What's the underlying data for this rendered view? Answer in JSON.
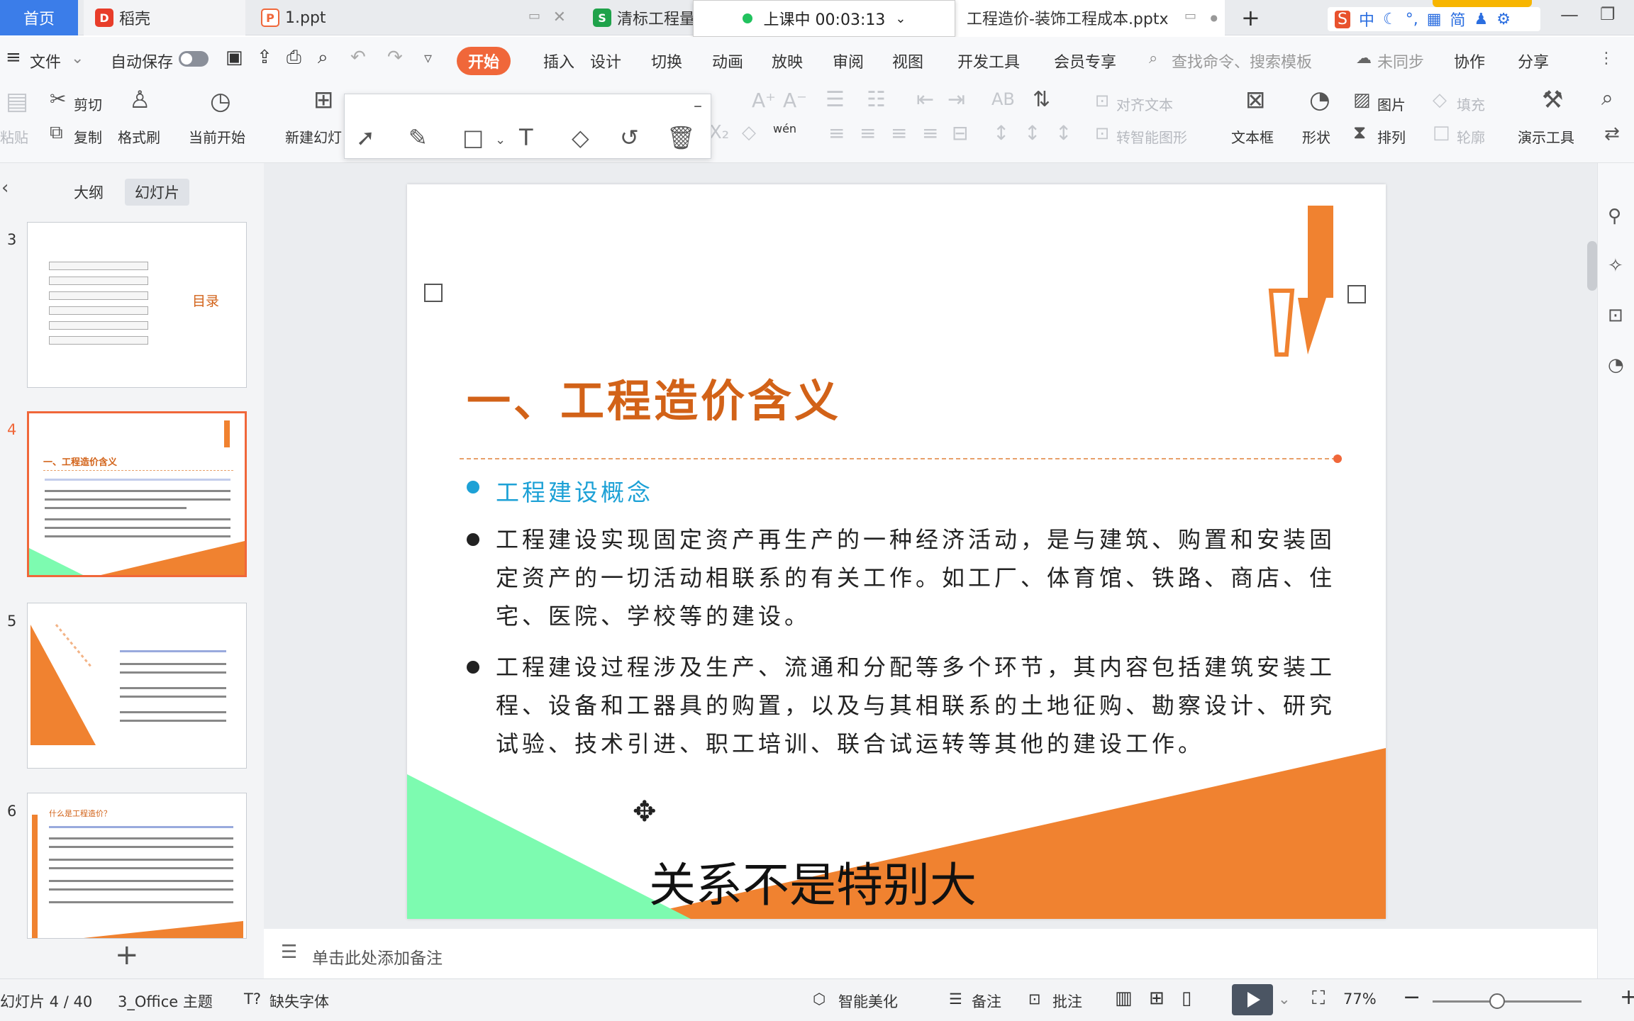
{
  "tabs": {
    "home": "首页",
    "docer": "稻壳",
    "ppt1": "1.ppt",
    "bid": "清标工程量",
    "cost": "工程造价-装饰工程成本.pptx",
    "new_tab": "+"
  },
  "recording": {
    "status": "上课中 00:03:13"
  },
  "sys": {
    "ime_zh": "中",
    "ime_simp": "简"
  },
  "menu": {
    "file": "文件",
    "autosave": "自动保存",
    "start": "开始",
    "insert": "插入",
    "design": "设计",
    "switch": "切换",
    "animation": "动画",
    "slideshow": "放映",
    "review": "审阅",
    "view": "视图",
    "devtools": "开发工具",
    "member": "会员专享",
    "search_placeholder": "查找命令、搜索模板",
    "sync": "未同步",
    "collab": "协作",
    "share": "分享"
  },
  "ribbon": {
    "paste": "粘贴",
    "cut": "剪切",
    "copy": "复制",
    "format_painter": "格式刷",
    "from_current": "当前开始",
    "new_slide": "新建幻灯",
    "align_text": "对齐文本",
    "smart_shape": "转智能图形",
    "textbox": "文本框",
    "shape": "形状",
    "picture": "图片",
    "fill": "填充",
    "arrange": "排列",
    "outline": "轮廓",
    "present_tools": "演示工具",
    "wen": "wén"
  },
  "panel": {
    "outline_tab": "大纲",
    "slides_tab": "幻灯片",
    "add": "+"
  },
  "thumbs": {
    "n3": "3",
    "n4": "4",
    "n5": "5",
    "n6": "6",
    "t3_label": "目录",
    "t4_title": "一、工程造价含义",
    "t6_title": "什么是工程造价？"
  },
  "slide": {
    "title": "一、工程造价含义",
    "concept": "工程建设概念",
    "para1": "工程建设实现固定资产再生产的一种经济活动，是与建筑、购置和安装固定资产的一切活动相联系的有关工作。如工厂、体育馆、铁路、商店、住宅、医院、学校等的建设。",
    "para2": "工程建设过程涉及生产、流通和分配等多个环节，其内容包括建筑安装工程、设备和工器具的购置，以及与其相联系的土地征购、勘察设计、研究试验、技术引进、职工培训、联合试运转等其他的建设工作。",
    "caption": "关系不是特别大"
  },
  "notes": {
    "placeholder": "单击此处添加备注"
  },
  "status": {
    "slide_count": "幻灯片 4 / 40",
    "theme": "3_Office 主题",
    "missing_font": "缺失字体",
    "beautify": "智能美化",
    "notes": "备注",
    "comment": "批注",
    "zoom": "77%"
  },
  "colors": {
    "accent": "#f0673a",
    "title": "#d26218",
    "concept": "#1da1d6",
    "green": "#7dfbb0"
  }
}
